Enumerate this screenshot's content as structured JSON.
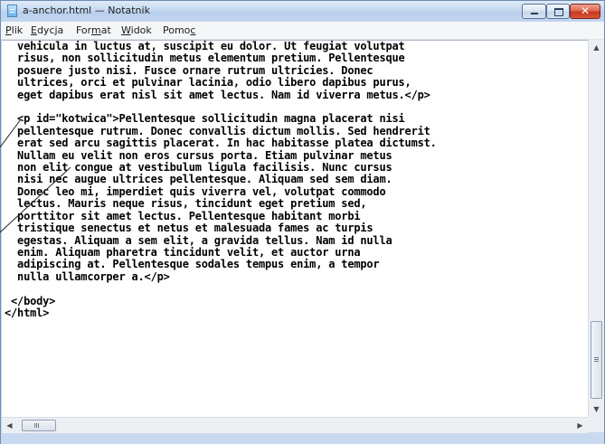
{
  "window": {
    "title": "a-anchor.html — Notatnik",
    "icon": "notepad-icon",
    "controls": {
      "minimize": "minimize-icon",
      "maximize": "maximize-icon",
      "close": "close-icon",
      "close_glyph": "✕"
    }
  },
  "menu": {
    "items": [
      {
        "pre": "",
        "key": "P",
        "post": "lik"
      },
      {
        "pre": "",
        "key": "E",
        "post": "dycja"
      },
      {
        "pre": "For",
        "key": "m",
        "post": "at"
      },
      {
        "pre": "",
        "key": "W",
        "post": "idok"
      },
      {
        "pre": "Pomo",
        "key": "c",
        "post": ""
      }
    ]
  },
  "editor": {
    "lines": [
      "  vehicula in luctus at, suscipit eu dolor. Ut feugiat volutpat",
      "  risus, non sollicitudin metus elementum pretium. Pellentesque",
      "  posuere justo nisi. Fusce ornare rutrum ultricies. Donec",
      "  ultrices, orci et pulvinar lacinia, odio libero dapibus purus,",
      "  eget dapibus erat nisl sit amet lectus. Nam id viverra metus.</p>",
      "",
      "  <p id=\"kotwica\">Pellentesque sollicitudin magna placerat nisi",
      "  pellentesque rutrum. Donec convallis dictum mollis. Sed hendrerit",
      "  erat sed arcu sagittis placerat. In hac habitasse platea dictumst.",
      "  Nullam eu velit non eros cursus porta. Etiam pulvinar metus",
      "  non elit congue at vestibulum ligula facilisis. Nunc cursus",
      "  nisi nec augue ultrices pellentesque. Aliquam sed sem diam.",
      "  Donec leo mi, imperdiet quis viverra vel, volutpat commodo",
      "  lectus. Mauris neque risus, tincidunt eget pretium sed,",
      "  porttitor sit amet lectus. Pellentesque habitant morbi",
      "  tristique senectus et netus et malesuada fames ac turpis",
      "  egestas. Aliquam a sem elit, a gravida tellus. Nam id nulla",
      "  enim. Aliquam pharetra tincidunt velit, et auctor urna",
      "  adipiscing at. Pellentesque sodales tempus enim, a tempor",
      "  nulla ullamcorper a.</p>",
      "",
      " </body>",
      "</html>"
    ]
  },
  "scrollbars": {
    "up_arrow": "▲",
    "down_arrow": "▼",
    "left_arrow": "◀",
    "right_arrow": "▶"
  }
}
